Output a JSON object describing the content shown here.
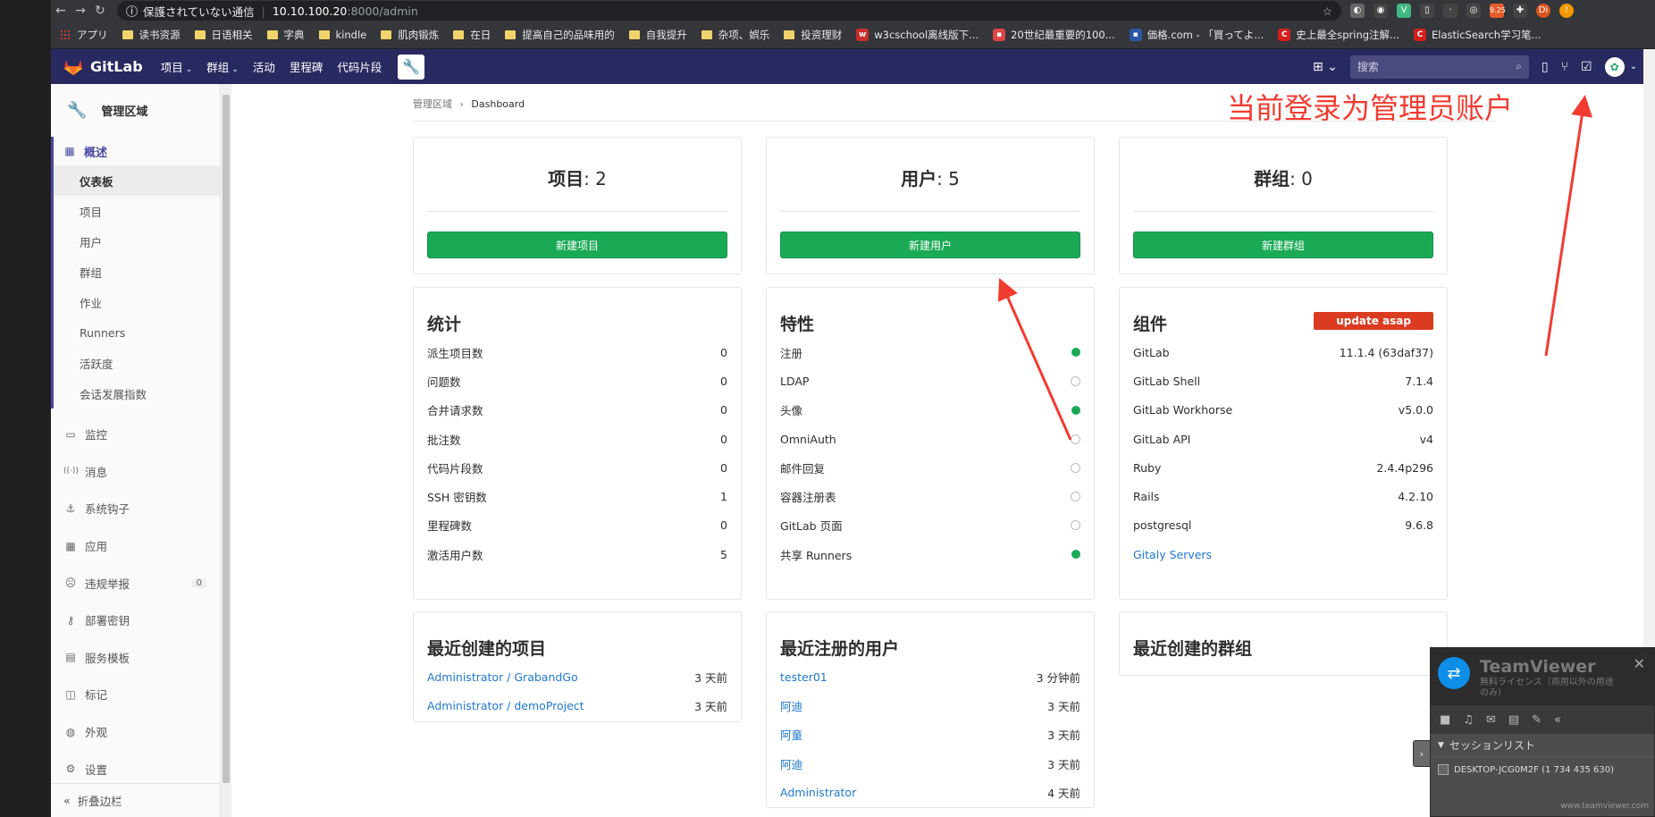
{
  "browser": {
    "security_text": "保護されていない通信",
    "url_host": "10.10.100.20",
    "url_path": ":8000/admin",
    "ext_badge": "9.25",
    "profile": "Di"
  },
  "bookmarks": [
    {
      "label": "アプリ",
      "type": "apps"
    },
    {
      "label": "读书资源",
      "type": "folder"
    },
    {
      "label": "日语相关",
      "type": "folder"
    },
    {
      "label": "字典",
      "type": "folder"
    },
    {
      "label": "kindle",
      "type": "folder"
    },
    {
      "label": "肌肉锻炼",
      "type": "folder"
    },
    {
      "label": "在日",
      "type": "folder"
    },
    {
      "label": "提高自己的品味用的",
      "type": "folder"
    },
    {
      "label": "自我提升",
      "type": "folder"
    },
    {
      "label": "杂项、娯乐",
      "type": "folder"
    },
    {
      "label": "投资理财",
      "type": "folder"
    },
    {
      "label": "w3cschool离线版下...",
      "type": "w3c"
    },
    {
      "label": "20世纪最重要的100...",
      "type": "site"
    },
    {
      "label": "価格.com - 「買ってよ...",
      "type": "kakaku"
    },
    {
      "label": "史上最全spring注解...",
      "type": "csdn"
    },
    {
      "label": "ElasticSearch学习笔...",
      "type": "csdn"
    }
  ],
  "header": {
    "brand": "GitLab",
    "nav": [
      "项目",
      "群组",
      "活动",
      "里程碑",
      "代码片段"
    ],
    "search_placeholder": "搜索"
  },
  "sidebar": {
    "title": "管理区域",
    "overview": "概述",
    "overview_items": [
      "仪表板",
      "项目",
      "用户",
      "群组",
      "作业",
      "Runners",
      "活跃度",
      "会话发展指数"
    ],
    "items": [
      {
        "label": "监控",
        "icon": "monitor-icon"
      },
      {
        "label": "消息",
        "icon": "broadcast-icon"
      },
      {
        "label": "系统钩子",
        "icon": "hook-icon"
      },
      {
        "label": "应用",
        "icon": "apps-icon"
      },
      {
        "label": "违规举报",
        "icon": "report-icon",
        "badge": "0"
      },
      {
        "label": "部署密钥",
        "icon": "key-icon"
      },
      {
        "label": "服务模板",
        "icon": "template-icon"
      },
      {
        "label": "标记",
        "icon": "label-icon"
      },
      {
        "label": "外观",
        "icon": "appearance-icon"
      },
      {
        "label": "设置",
        "icon": "settings-icon"
      }
    ],
    "collapse": "折叠边栏"
  },
  "breadcrumb": {
    "parent": "管理区域",
    "current": "Dashboard"
  },
  "counts": [
    {
      "label": "项目",
      "count": ": 2",
      "button": "新建项目"
    },
    {
      "label": "用户",
      "count": ": 5",
      "button": "新建用户"
    },
    {
      "label": "群组",
      "count": ": 0",
      "button": "新建群组"
    }
  ],
  "stats": {
    "title": "统计",
    "rows": [
      {
        "k": "派生项目数",
        "v": "0"
      },
      {
        "k": "问题数",
        "v": "0"
      },
      {
        "k": "合并请求数",
        "v": "0"
      },
      {
        "k": "批注数",
        "v": "0"
      },
      {
        "k": "代码片段数",
        "v": "0"
      },
      {
        "k": "SSH 密钥数",
        "v": "1"
      },
      {
        "k": "里程碑数",
        "v": "0"
      },
      {
        "k": "激活用户数",
        "v": "5"
      }
    ]
  },
  "features": {
    "title": "特性",
    "rows": [
      {
        "k": "注册",
        "on": true
      },
      {
        "k": "LDAP",
        "on": false
      },
      {
        "k": "头像",
        "on": true
      },
      {
        "k": "OmniAuth",
        "on": false
      },
      {
        "k": "邮件回复",
        "on": false
      },
      {
        "k": "容器注册表",
        "on": false
      },
      {
        "k": "GitLab 页面",
        "on": false
      },
      {
        "k": "共享 Runners",
        "on": true
      }
    ]
  },
  "components": {
    "title": "组件",
    "update": "update asap",
    "rows": [
      {
        "k": "GitLab",
        "v": "11.1.4 (63daf37)"
      },
      {
        "k": "GitLab Shell",
        "v": "7.1.4"
      },
      {
        "k": "GitLab Workhorse",
        "v": "v5.0.0"
      },
      {
        "k": "GitLab API",
        "v": "v4"
      },
      {
        "k": "Ruby",
        "v": "2.4.4p296"
      },
      {
        "k": "Rails",
        "v": "4.2.10"
      },
      {
        "k": "postgresql",
        "v": "9.6.8"
      }
    ],
    "gitaly": "Gitaly Servers"
  },
  "recent_projects": {
    "title": "最近创建的项目",
    "rows": [
      {
        "k": "Administrator / GrabandGo",
        "v": "3 天前"
      },
      {
        "k": "Administrator / demoProject",
        "v": "3 天前"
      }
    ]
  },
  "recent_users": {
    "title": "最近注册的用户",
    "rows": [
      {
        "k": "tester01",
        "v": "3 分钟前"
      },
      {
        "k": "阿迪",
        "v": "3 天前"
      },
      {
        "k": "阿童",
        "v": "3 天前"
      },
      {
        "k": "阿迪",
        "v": "3 天前"
      },
      {
        "k": "Administrator",
        "v": "4 天前"
      }
    ]
  },
  "recent_groups": {
    "title": "最近创建的群组"
  },
  "annotation": "当前登录为管理员账户",
  "teamviewer": {
    "name": "TeamViewer",
    "license": "無料ライセンス（商用以外の用途のみ）",
    "session_list": "セッションリスト",
    "device": "DESKTOP-JCG0M2F (1 734 435 630)",
    "footer": "www.teamviewer.com"
  }
}
